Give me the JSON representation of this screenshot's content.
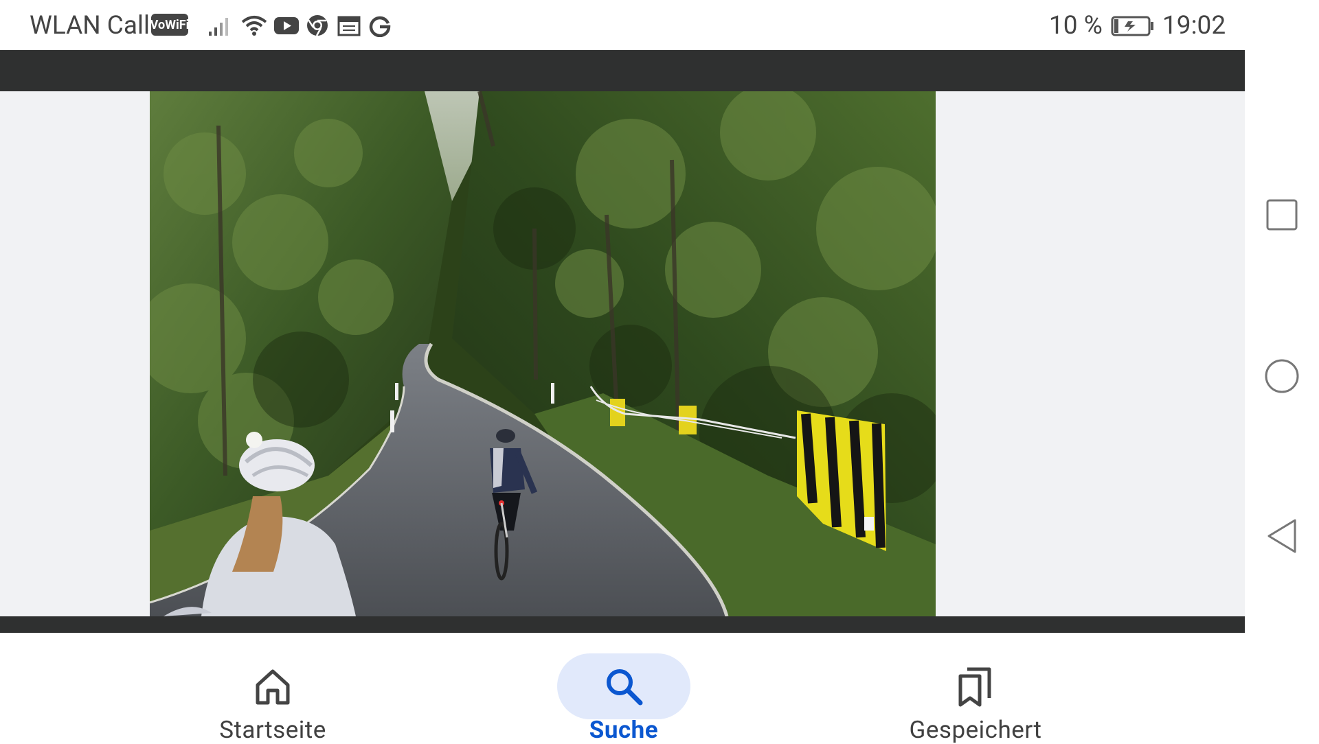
{
  "status_bar": {
    "carrier_label": "WLAN Call",
    "vowifi_badge": "VoWiFi",
    "icons": [
      "signal-icon",
      "wifi-icon",
      "youtube-icon",
      "chrome-icon",
      "calendar-icon",
      "google-icon"
    ],
    "battery_percent": "10 %",
    "battery_icon": "battery-charging-icon",
    "time": "19:02"
  },
  "viewer": {
    "image_subject": "cyclists-on-forest-road",
    "top_bar_color": "#2f3030",
    "background_color": "#f1f2f4"
  },
  "bottom_nav": {
    "items": [
      {
        "label": "Startseite",
        "icon": "home-icon",
        "active": false
      },
      {
        "label": "Suche",
        "icon": "search-icon",
        "active": true
      },
      {
        "label": "Gespeichert",
        "icon": "bookmarks-icon",
        "active": false
      }
    ],
    "active_color": "#0b57d0",
    "active_pill_color": "#e1e9fb"
  },
  "system_nav": {
    "buttons": [
      "recents-button",
      "home-button",
      "back-button"
    ]
  }
}
